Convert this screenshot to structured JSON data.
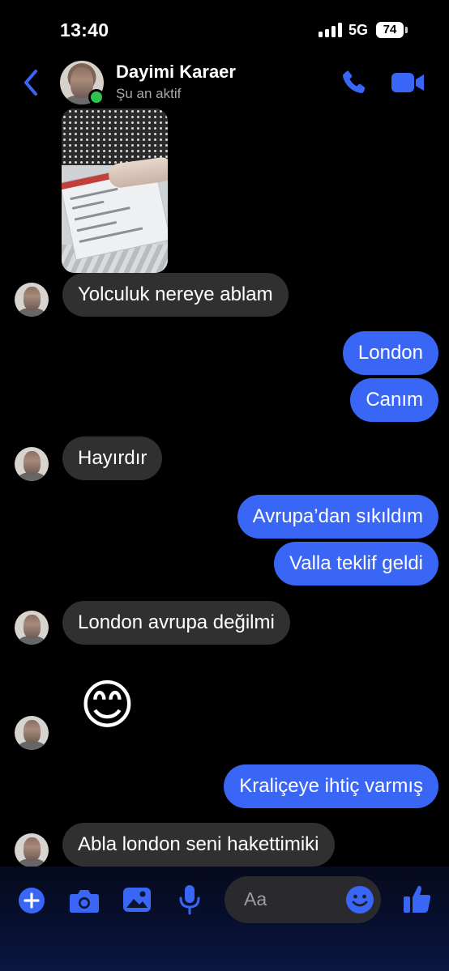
{
  "status_bar": {
    "time": "13:40",
    "network": "5G",
    "battery": "74"
  },
  "header": {
    "name": "Dayimi Karaer",
    "status": "Şu an aktif"
  },
  "messages": [
    {
      "side": "in",
      "text": "Yolculuk nereye ablam"
    },
    {
      "side": "out",
      "text": "London"
    },
    {
      "side": "out",
      "text": "Canım"
    },
    {
      "side": "in",
      "text": "Hayırdır"
    },
    {
      "side": "out",
      "text": "Avrupa’dan sıkıldım"
    },
    {
      "side": "out",
      "text": "Valla teklif geldi"
    },
    {
      "side": "in",
      "text": "London avrupa değilmi"
    },
    {
      "side": "in",
      "text": "😊"
    },
    {
      "side": "out",
      "text": "Kraliçeye ihtiç varmış"
    },
    {
      "side": "in",
      "text": "Abla london seni hakettimiki"
    }
  ],
  "composer": {
    "placeholder": "Aa"
  },
  "colors": {
    "accent": "#3a66f5",
    "incoming_bubble": "#303030",
    "online": "#31c24d"
  },
  "icons": [
    "back-chevron-icon",
    "phone-icon",
    "video-camera-icon",
    "plus-icon",
    "camera-icon",
    "gallery-icon",
    "microphone-icon",
    "emoji-icon",
    "thumbs-up-icon"
  ]
}
